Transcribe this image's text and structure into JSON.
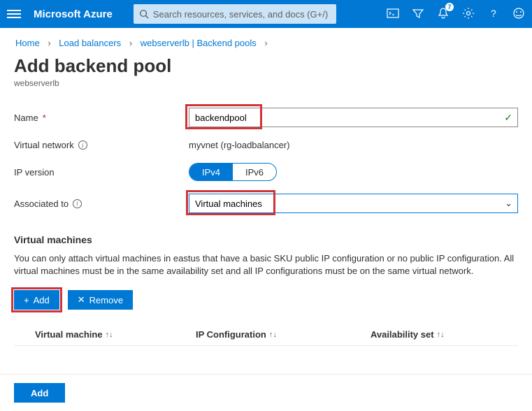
{
  "topbar": {
    "brand": "Microsoft Azure",
    "search_placeholder": "Search resources, services, and docs (G+/)",
    "notification_count": "7"
  },
  "breadcrumb": {
    "items": [
      "Home",
      "Load balancers",
      "webserverlb | Backend pools"
    ]
  },
  "page": {
    "title": "Add backend pool",
    "subtitle": "webserverlb"
  },
  "form": {
    "name_label": "Name",
    "name_value": "backendpool",
    "vnet_label": "Virtual network",
    "vnet_value": "myvnet (rg-loadbalancer)",
    "ipversion_label": "IP version",
    "ipv4": "IPv4",
    "ipv6": "IPv6",
    "associated_label": "Associated to",
    "associated_value": "Virtual machines"
  },
  "vm_section": {
    "title": "Virtual machines",
    "desc": "You can only attach virtual machines in eastus that have a basic SKU public IP configuration or no public IP configuration. All virtual machines must be in the same availability set and all IP configurations must be on the same virtual network.",
    "add_btn": "Add",
    "remove_btn": "Remove",
    "col_vm": "Virtual machine",
    "col_ip": "IP Configuration",
    "col_avail": "Availability set"
  },
  "footer": {
    "add_btn": "Add"
  }
}
